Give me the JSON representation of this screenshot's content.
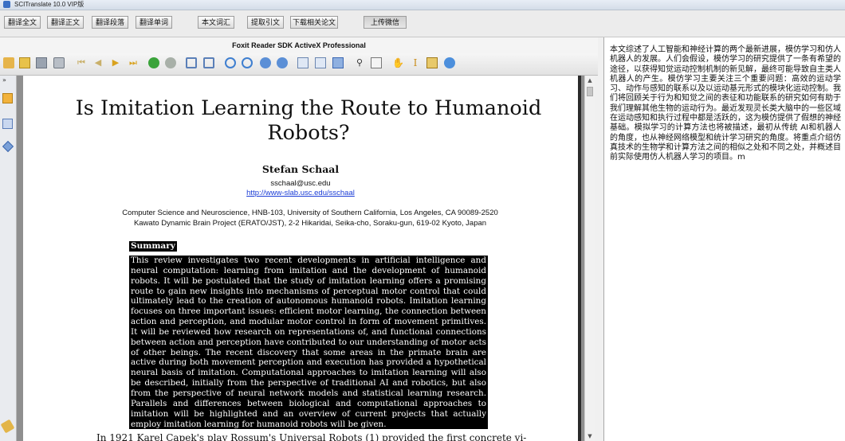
{
  "window": {
    "title": "SCITranslate 10.0 VIP版"
  },
  "top_buttons": [
    "翻译全文",
    "翻译正文",
    "翻译段落",
    "翻译单词",
    "本文词汇",
    "提取引文",
    "下载相关论文",
    "上传微信"
  ],
  "viewer": {
    "title": "Foxit Reader SDK ActiveX Professional"
  },
  "toolbar_icons": [
    "hand-pointer-icon",
    "open-icon",
    "save-icon",
    "print-icon",
    "first-page-icon",
    "prev-page-icon",
    "next-page-icon",
    "last-page-icon",
    "go-back-icon",
    "go-forward-icon",
    "rotate-left-icon",
    "rotate-right-icon",
    "zoom-in-icon",
    "zoom-out-icon",
    "zoom-plus-icon",
    "zoom-minus-icon",
    "fit-page-icon",
    "fit-width-icon",
    "actual-size-icon",
    "find-icon",
    "bookmark-icon",
    "hand-tool-icon",
    "text-select-icon",
    "snapshot-icon",
    "about-icon"
  ],
  "sidebar_icons": [
    "pages-icon",
    "layers-icon",
    "attachments-icon",
    "pen-icon"
  ],
  "paper": {
    "title": "Is Imitation Learning the Route to Humanoid Robots?",
    "author": "Stefan Schaal",
    "email": "sschaal@usc.edu",
    "url": "http://www-slab.usc.edu/sschaal",
    "affiliation1": "Computer Science and Neuroscience, HNB-103, University of Southern California, Los Angeles, CA 90089-2520",
    "affiliation2": "Kawato Dynamic Brain Project (ERATO/JST), 2-2 Hikaridai, Seika-cho, Soraku-gun, 619-02 Kyoto, Japan",
    "summary_label": "Summary",
    "abstract": "This review investigates two recent developments in artificial intelligence and neural computation: learning from imitation and the development of humanoid robots. It will be postulated that the study of imitation learning offers a promising route to gain new insights into mechanisms of perceptual motor control that could ultimately lead to the creation of autonomous humanoid robots. Imitation learning focuses on three important issues: efficient motor learning, the connection between action and perception, and modular motor control in form of movement primitives. It will be reviewed how research on representations of, and functional connections between action and perception have contributed to our understanding of motor acts of other beings. The recent discovery that some areas in the primate brain are active during both movement perception and execution has provided a hypothetical neural basis of imitation. Computational approaches to imitation learning will also be described, initially from the perspective of traditional AI and robotics, but also from the perspective of neural network models and statistical learning research. Parallels and differences between biological and computational approaches to imitation will be highlighted and an overview of current projects that actually employ imitation learning for humanoid robots will be given.",
    "body_start": "In 1921 Karel Capek's play Rossum's Universal Robots (1) provided the first concrete vi-"
  },
  "translation": "本文综述了人工智能和神经计算的两个最新进展，模仿学习和仿人机器人的发展。人们会假设，模仿学习的研究提供了一条有希望的途径，以获得知觉运动控制机制的新见解，最终可能导致自主类人机器人的产生。模仿学习主要关注三个重要问题：高效的运动学习、动作与感知的联系以及以运动基元形式的模块化运动控制。我们将回顾关于行为和知觉之间的表征和功能联系的研究如何有助于我们理解其他生物的运动行为。最近发现灵长类大脑中的一些区域在运动感知和执行过程中都是活跃的，这为模仿提供了假想的神经基础。模拟学习的计算方法也将被描述，最初从传统 AI和机器人的角度，也从神经网络模型和统计学习研究的角度。将重点介绍仿真技术的生物学和计算方法之间的相似之处和不同之处，并概述目前实际使用仿人机器人学习的项目。m"
}
